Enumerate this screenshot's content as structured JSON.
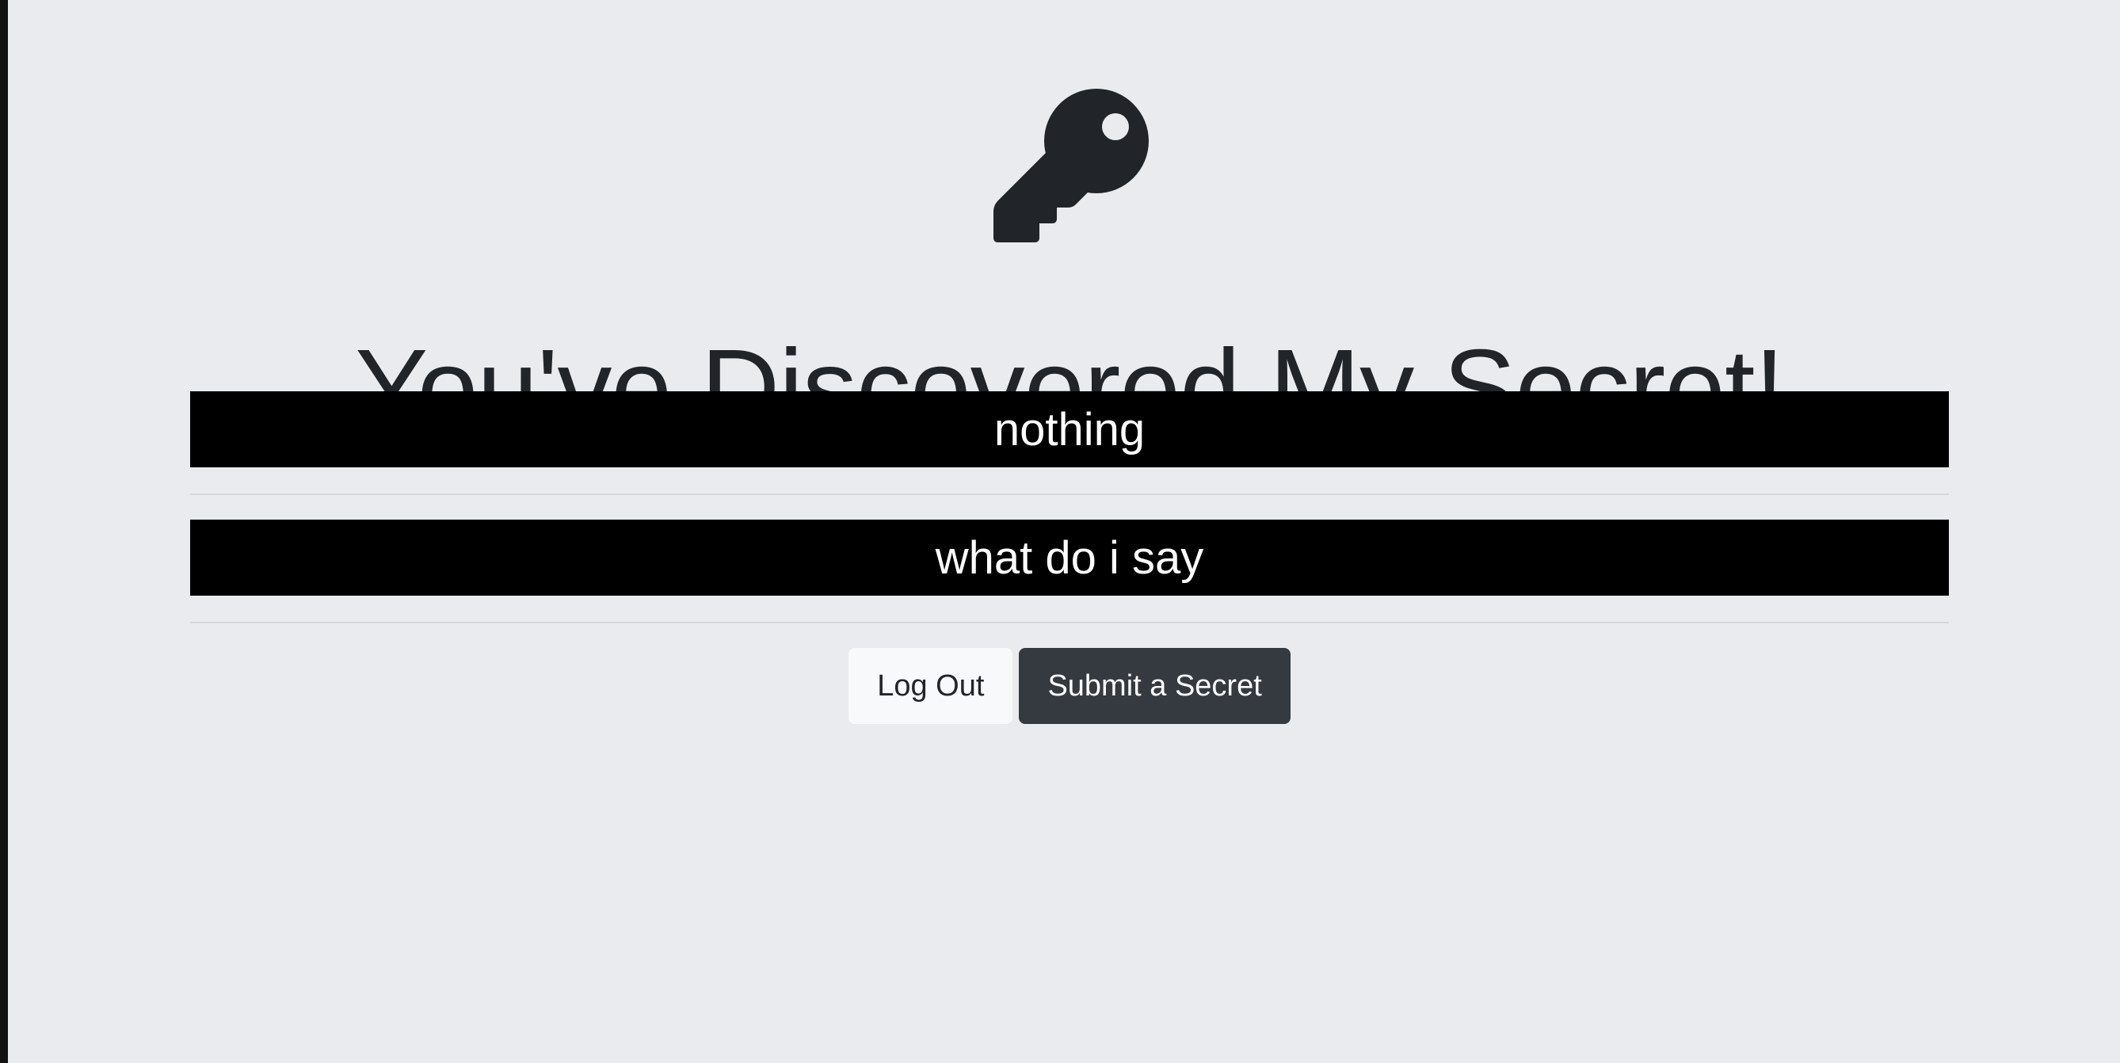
{
  "page": {
    "icon": "key-icon",
    "title": "You've Discovered My Secret!"
  },
  "secrets": [
    {
      "text": "nothing"
    },
    {
      "text": "what do i say"
    }
  ],
  "actions": {
    "logout_label": "Log Out",
    "submit_label": "Submit a Secret"
  },
  "colors": {
    "background": "#e9ebef",
    "text": "#212529",
    "secret_background": "#000000",
    "secret_text": "#ffffff",
    "light_button": "#f8f9fa",
    "dark_button": "#343a40"
  }
}
